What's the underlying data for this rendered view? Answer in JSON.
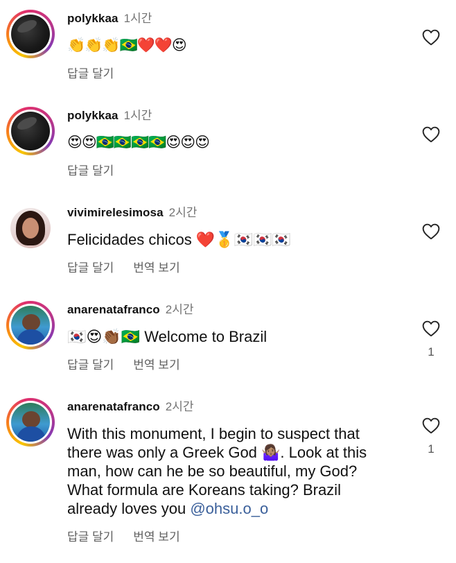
{
  "comments": [
    {
      "username": "polykkaa",
      "time": "1시간",
      "text": "👏👏👏🇧🇷❤️❤️😍",
      "reply": "답글 달기",
      "translate": "",
      "likes": ""
    },
    {
      "username": "polykkaa",
      "time": "1시간",
      "text": "😍😍🇧🇷🇧🇷🇧🇷🇧🇷😍😍😍",
      "reply": "답글 달기",
      "translate": "",
      "likes": ""
    },
    {
      "username": "vivimirelesimosa",
      "time": "2시간",
      "text": "Felicidades chicos ❤️🥇🇰🇷🇰🇷🇰🇷",
      "reply": "답글 달기",
      "translate": "번역 보기",
      "likes": ""
    },
    {
      "username": "anarenatafranco",
      "time": "2시간",
      "text": "🇰🇷😍👏🏾🇧🇷 Welcome to Brazil",
      "reply": "답글 달기",
      "translate": "번역 보기",
      "likes": "1"
    },
    {
      "username": "anarenatafranco",
      "time": "2시간",
      "text": "With this monument, I begin to suspect that there was only a Greek God 🤷🏽‍♀️. Look at this man, how can he be so beautiful, my God? What formula are Koreans taking? Brazil already loves you",
      "mention": "@ohsu.o_o",
      "reply": "답글 달기",
      "translate": "번역 보기",
      "likes": "1"
    }
  ],
  "icons": {
    "like": "heart-outline-icon"
  },
  "colors": {
    "story_ring_start": "#f9c600",
    "story_ring_end": "#833ab4",
    "mention": "#3a5f9a",
    "secondary_text": "#737373"
  }
}
